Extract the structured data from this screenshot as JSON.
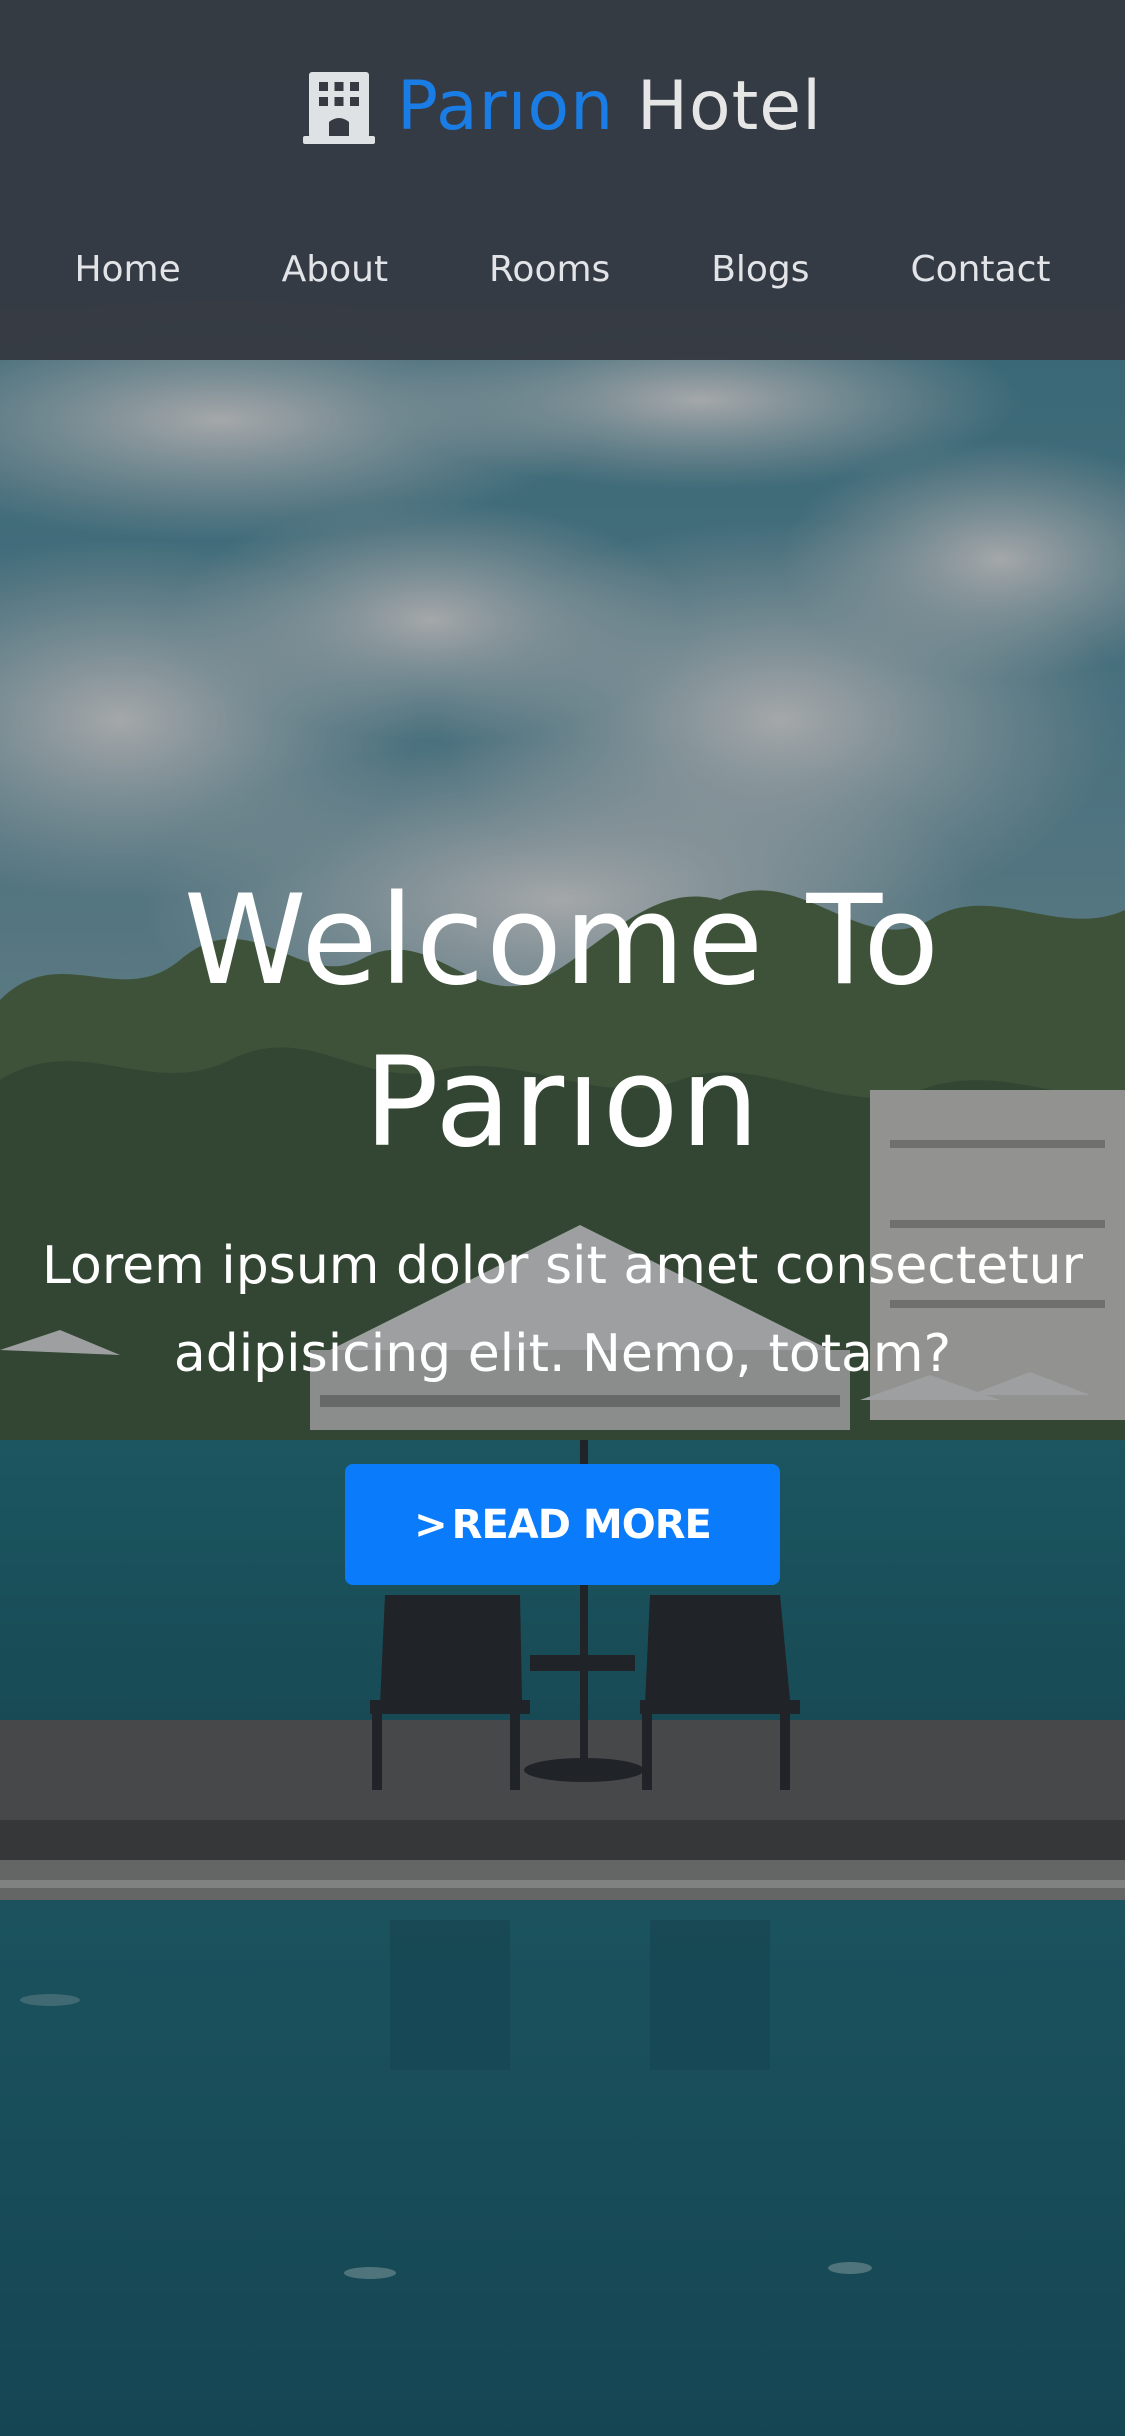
{
  "brand": {
    "name_accent": "Parıon",
    "name_rest": "Hotel",
    "accent_color": "#1a7de6",
    "icon": "hotel-building-icon"
  },
  "nav": {
    "items": [
      {
        "label": "Home"
      },
      {
        "label": "About"
      },
      {
        "label": "Rooms"
      },
      {
        "label": "Blogs"
      },
      {
        "label": "Contact"
      }
    ]
  },
  "hero": {
    "title_line1": "Welcome To",
    "title_line2": "Parıon",
    "subtitle_line1": "Lorem ipsum dolor sit amet consectetur",
    "subtitle_line2": "adipisicing elit. Nemo, totam?",
    "cta": {
      "icon": "chevron-right-icon",
      "label": "READ MORE",
      "color": "#0a7cfb"
    }
  }
}
